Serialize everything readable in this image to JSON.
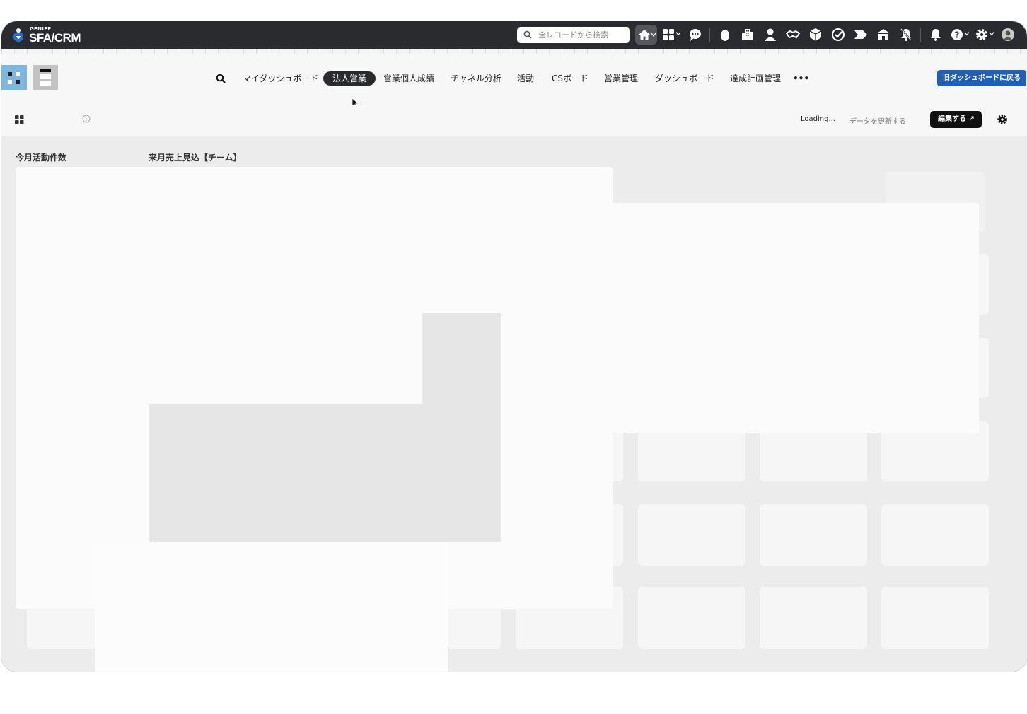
{
  "topbar": {
    "logo_small": "GENIEE",
    "logo_big": "SFA/CRM",
    "search_placeholder": "全レコードから検索",
    "icons": [
      "home-icon",
      "apps-grid-icon",
      "chat-icon",
      "lead-icon",
      "company-icon",
      "contact-icon",
      "deal-icon",
      "product-icon",
      "task-icon",
      "tag-icon",
      "institution-icon",
      "notification-off-icon",
      "bell-icon",
      "help-icon",
      "settings-icon",
      "avatar"
    ]
  },
  "nav": {
    "items": [
      "マイダッシュボード",
      "法人営業",
      "営業個人成績",
      "チャネル分析",
      "活動",
      "CSボード",
      "営業管理",
      "ダッシュボード",
      "達成計画管理"
    ],
    "active": "法人営業",
    "more": "•••",
    "old_dashboard_button": "旧ダッシュボードに戻る"
  },
  "subbar": {
    "loading": "Loading...",
    "refresh": "データを更新する",
    "edit_button": "編集する ↗"
  },
  "widgets": {
    "label_1": "今月活動件数",
    "label_2": "来月売上見込【チーム】"
  },
  "colors": {
    "topbar": "#2a2b2f",
    "accent_blue": "#1f5fb8",
    "active_tab": "#2a2b2f",
    "view_toggle_active": "#7db7e0"
  }
}
